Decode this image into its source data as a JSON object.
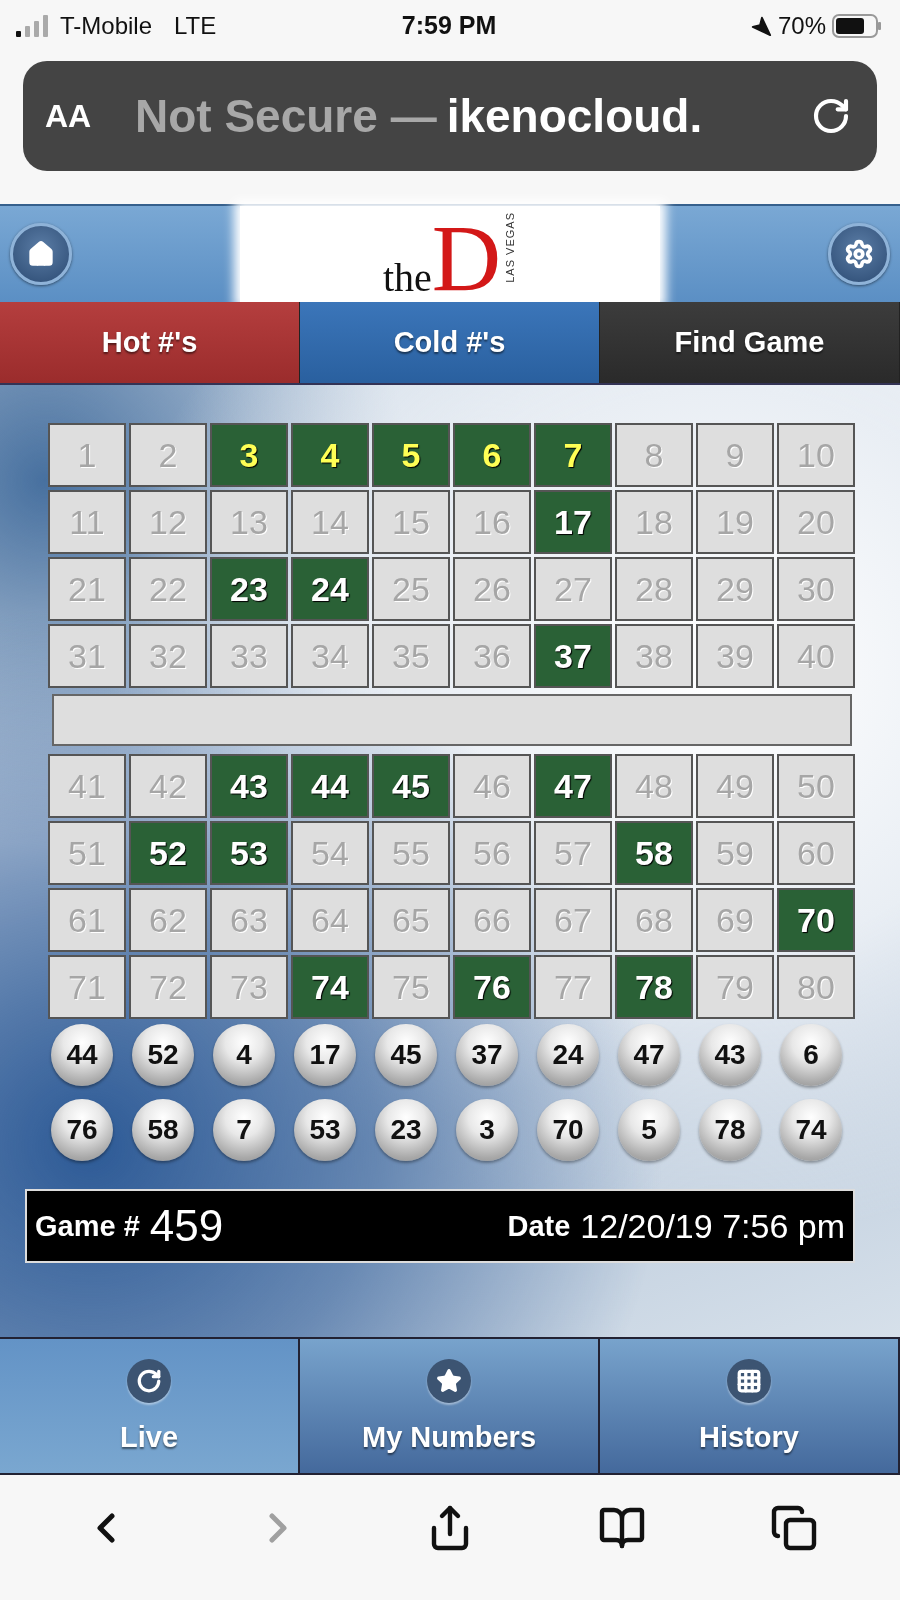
{
  "status_bar": {
    "carrier": "T-Mobile",
    "network": "LTE",
    "time": "7:59 PM",
    "battery": "70%"
  },
  "address_bar": {
    "text_size": "AA",
    "security": "Not Secure —",
    "domain": "ikenocloud."
  },
  "header": {
    "logo": {
      "the": "the",
      "letter": "D",
      "city": "LAS VEGAS"
    }
  },
  "tabs": [
    {
      "label": "Hot #'s",
      "color": "#b03232"
    },
    {
      "label": "Cold #'s",
      "color": "#2f6db5"
    },
    {
      "label": "Find Game",
      "color": "#303030"
    }
  ],
  "board_top": [
    [
      {
        "n": "1",
        "drawn": false,
        "highlighted": false
      },
      {
        "n": "2",
        "drawn": false,
        "highlighted": false
      },
      {
        "n": "3",
        "drawn": true,
        "highlighted": true
      },
      {
        "n": "4",
        "drawn": true,
        "highlighted": true
      },
      {
        "n": "5",
        "drawn": true,
        "highlighted": true
      },
      {
        "n": "6",
        "drawn": true,
        "highlighted": true
      },
      {
        "n": "7",
        "drawn": true,
        "highlighted": true
      },
      {
        "n": "8",
        "drawn": false,
        "highlighted": false
      },
      {
        "n": "9",
        "drawn": false,
        "highlighted": false
      },
      {
        "n": "10",
        "drawn": false,
        "highlighted": false
      }
    ],
    [
      {
        "n": "11",
        "drawn": false,
        "highlighted": false
      },
      {
        "n": "12",
        "drawn": false,
        "highlighted": false
      },
      {
        "n": "13",
        "drawn": false,
        "highlighted": false
      },
      {
        "n": "14",
        "drawn": false,
        "highlighted": false
      },
      {
        "n": "15",
        "drawn": false,
        "highlighted": false
      },
      {
        "n": "16",
        "drawn": false,
        "highlighted": false
      },
      {
        "n": "17",
        "drawn": true,
        "highlighted": false
      },
      {
        "n": "18",
        "drawn": false,
        "highlighted": false
      },
      {
        "n": "19",
        "drawn": false,
        "highlighted": false
      },
      {
        "n": "20",
        "drawn": false,
        "highlighted": false
      }
    ],
    [
      {
        "n": "21",
        "drawn": false,
        "highlighted": false
      },
      {
        "n": "22",
        "drawn": false,
        "highlighted": false
      },
      {
        "n": "23",
        "drawn": true,
        "highlighted": false
      },
      {
        "n": "24",
        "drawn": true,
        "highlighted": false
      },
      {
        "n": "25",
        "drawn": false,
        "highlighted": false
      },
      {
        "n": "26",
        "drawn": false,
        "highlighted": false
      },
      {
        "n": "27",
        "drawn": false,
        "highlighted": false
      },
      {
        "n": "28",
        "drawn": false,
        "highlighted": false
      },
      {
        "n": "29",
        "drawn": false,
        "highlighted": false
      },
      {
        "n": "30",
        "drawn": false,
        "highlighted": false
      }
    ],
    [
      {
        "n": "31",
        "drawn": false,
        "highlighted": false
      },
      {
        "n": "32",
        "drawn": false,
        "highlighted": false
      },
      {
        "n": "33",
        "drawn": false,
        "highlighted": false
      },
      {
        "n": "34",
        "drawn": false,
        "highlighted": false
      },
      {
        "n": "35",
        "drawn": false,
        "highlighted": false
      },
      {
        "n": "36",
        "drawn": false,
        "highlighted": false
      },
      {
        "n": "37",
        "drawn": true,
        "highlighted": false
      },
      {
        "n": "38",
        "drawn": false,
        "highlighted": false
      },
      {
        "n": "39",
        "drawn": false,
        "highlighted": false
      },
      {
        "n": "40",
        "drawn": false,
        "highlighted": false
      }
    ]
  ],
  "board_bottom": [
    [
      {
        "n": "41",
        "drawn": false,
        "highlighted": false
      },
      {
        "n": "42",
        "drawn": false,
        "highlighted": false
      },
      {
        "n": "43",
        "drawn": true,
        "highlighted": false
      },
      {
        "n": "44",
        "drawn": true,
        "highlighted": false
      },
      {
        "n": "45",
        "drawn": true,
        "highlighted": false
      },
      {
        "n": "46",
        "drawn": false,
        "highlighted": false
      },
      {
        "n": "47",
        "drawn": true,
        "highlighted": false
      },
      {
        "n": "48",
        "drawn": false,
        "highlighted": false
      },
      {
        "n": "49",
        "drawn": false,
        "highlighted": false
      },
      {
        "n": "50",
        "drawn": false,
        "highlighted": false
      }
    ],
    [
      {
        "n": "51",
        "drawn": false,
        "highlighted": false
      },
      {
        "n": "52",
        "drawn": true,
        "highlighted": false
      },
      {
        "n": "53",
        "drawn": true,
        "highlighted": false
      },
      {
        "n": "54",
        "drawn": false,
        "highlighted": false
      },
      {
        "n": "55",
        "drawn": false,
        "highlighted": false
      },
      {
        "n": "56",
        "drawn": false,
        "highlighted": false
      },
      {
        "n": "57",
        "drawn": false,
        "highlighted": false
      },
      {
        "n": "58",
        "drawn": true,
        "highlighted": false
      },
      {
        "n": "59",
        "drawn": false,
        "highlighted": false
      },
      {
        "n": "60",
        "drawn": false,
        "highlighted": false
      }
    ],
    [
      {
        "n": "61",
        "drawn": false,
        "highlighted": false
      },
      {
        "n": "62",
        "drawn": false,
        "highlighted": false
      },
      {
        "n": "63",
        "drawn": false,
        "highlighted": false
      },
      {
        "n": "64",
        "drawn": false,
        "highlighted": false
      },
      {
        "n": "65",
        "drawn": false,
        "highlighted": false
      },
      {
        "n": "66",
        "drawn": false,
        "highlighted": false
      },
      {
        "n": "67",
        "drawn": false,
        "highlighted": false
      },
      {
        "n": "68",
        "drawn": false,
        "highlighted": false
      },
      {
        "n": "69",
        "drawn": false,
        "highlighted": false
      },
      {
        "n": "70",
        "drawn": true,
        "highlighted": false
      }
    ],
    [
      {
        "n": "71",
        "drawn": false,
        "highlighted": false
      },
      {
        "n": "72",
        "drawn": false,
        "highlighted": false
      },
      {
        "n": "73",
        "drawn": false,
        "highlighted": false
      },
      {
        "n": "74",
        "drawn": true,
        "highlighted": false
      },
      {
        "n": "75",
        "drawn": false,
        "highlighted": false
      },
      {
        "n": "76",
        "drawn": true,
        "highlighted": false
      },
      {
        "n": "77",
        "drawn": false,
        "highlighted": false
      },
      {
        "n": "78",
        "drawn": true,
        "highlighted": false
      },
      {
        "n": "79",
        "drawn": false,
        "highlighted": false
      },
      {
        "n": "80",
        "drawn": false,
        "highlighted": false
      }
    ]
  ],
  "balls": [
    "44",
    "52",
    "4",
    "17",
    "45",
    "37",
    "24",
    "47",
    "43",
    "6",
    "76",
    "58",
    "7",
    "53",
    "23",
    "3",
    "70",
    "5",
    "78",
    "74"
  ],
  "game_bar": {
    "game_label": "Game #",
    "game_number": "459",
    "date_label": "Date",
    "date": "12/20/19 7:56 pm"
  },
  "bottom_nav": [
    {
      "label": "Live",
      "kind": "live",
      "selected": true
    },
    {
      "label": "My Numbers",
      "kind": "star",
      "selected": false
    },
    {
      "label": "History",
      "kind": "grid",
      "selected": false
    }
  ],
  "browser_toolbar": [
    {
      "kind": "back",
      "disabled": false
    },
    {
      "kind": "forward",
      "disabled": true
    },
    {
      "kind": "share",
      "disabled": false
    },
    {
      "kind": "bookmarks",
      "disabled": false
    },
    {
      "kind": "tabs",
      "disabled": false
    }
  ]
}
